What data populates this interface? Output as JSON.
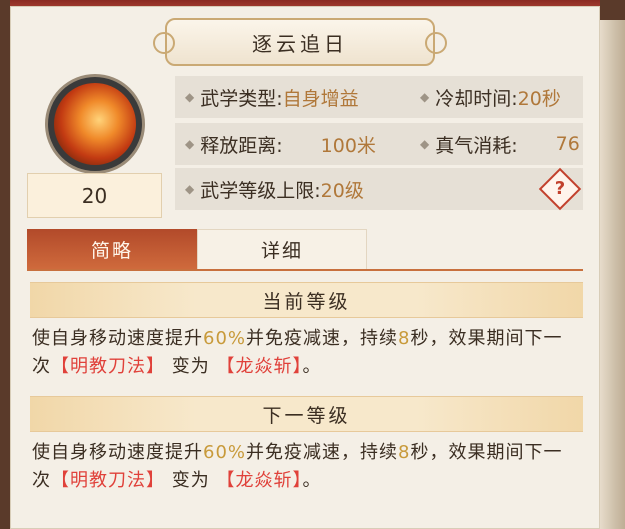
{
  "skill": {
    "title": "逐云追日",
    "level": "20"
  },
  "info": {
    "type_label": "武学类型:",
    "type_value": "自身增益",
    "cooldown_label": "冷却时间:",
    "cooldown_value": "20秒",
    "range_label": "释放距离:",
    "range_value": "100米",
    "energy_label": "真气消耗:",
    "energy_value": "76",
    "maxlevel_label": "武学等级上限:",
    "maxlevel_value": "20级",
    "help_glyph": "?"
  },
  "tabs": {
    "brief": "简略",
    "detail": "详细"
  },
  "current": {
    "header": "当前等级",
    "p1": "使自身移动速度提升",
    "pct": "60%",
    "p2": "并免疫减速，持续",
    "sec": "8",
    "p3": "秒，效果期间下一次",
    "skill_a": "【明教刀法】",
    "p4": "变为",
    "skill_b": "【龙焱斩】",
    "p5": "。"
  },
  "next": {
    "header": "下一等级",
    "p1": "使自身移动速度提升",
    "pct": "60%",
    "p2": "并免疫减速，持续",
    "sec": "8",
    "p3": "秒，效果期间下一次",
    "skill_a": "【明教刀法】",
    "p4": "变为",
    "skill_b": "【龙焱斩】",
    "p5": "。"
  },
  "colors": {
    "highlight_red": "#e0413a",
    "value_gold": "#b0783a",
    "tab_active": "#cf6a3c"
  }
}
